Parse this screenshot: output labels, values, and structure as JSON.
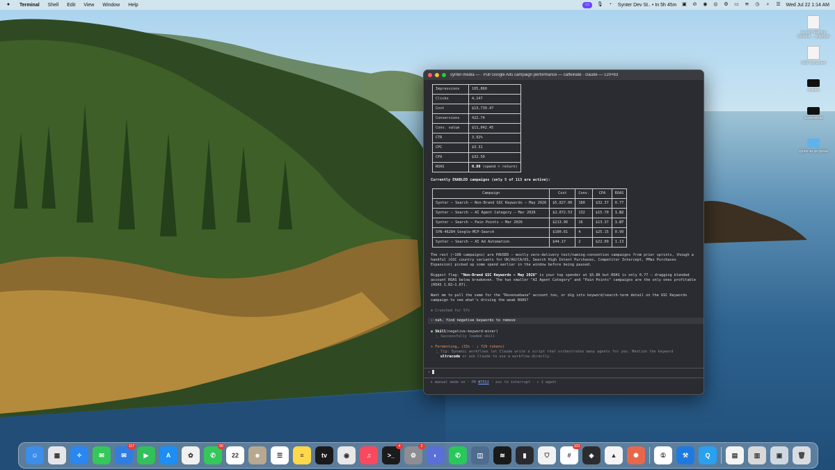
{
  "menubar": {
    "apple": "",
    "app_name": "Terminal",
    "menus": [
      "Shell",
      "Edit",
      "View",
      "Window",
      "Help"
    ],
    "status_item": "Synter Dev St.. • In 5h 45m",
    "datetime": "Wed Jul 22  1:14 AM"
  },
  "desktop_icons": [
    {
      "label": "Jackson Fashion Seminar ... script.pdf",
      "icon": "document-icon"
    },
    {
      "label": "WEF Document",
      "icon": "document-icon"
    },
    {
      "label": "Untitled",
      "icon": "display-icon"
    },
    {
      "label": "Screenshots",
      "icon": "printer-icon"
    },
    {
      "label": "synter-ex-proposal",
      "icon": "folder-icon"
    }
  ],
  "terminal": {
    "title": "synter-media — · Pull Google Ads campaign performance — caffeinate · claude — 120×63",
    "metrics": [
      {
        "label": "Impressions",
        "value": "105,860"
      },
      {
        "label": "Clicks",
        "value": "4,147"
      },
      {
        "label": "Cost",
        "value": "$13,739.47"
      },
      {
        "label": "Conversions",
        "value": "422.74"
      },
      {
        "label": "Conv. value",
        "value": "$11,042.45"
      },
      {
        "label": "CTR",
        "value": "3.92%"
      },
      {
        "label": "CPC",
        "value": "$3.31"
      },
      {
        "label": "CPA",
        "value": "$32.50"
      },
      {
        "label": "ROAS",
        "value": "0.80",
        "note": "(spend > return)"
      }
    ],
    "campaigns_heading": "Currently ENABLED campaigns (only 5 of 113 are active):",
    "campaign_headers": [
      "Campaign",
      "Cost",
      "Conv.",
      "CPA",
      "ROAS"
    ],
    "campaigns": [
      {
        "name": "Synter – Search – Non-Brand GSC Keywords – May 2026",
        "cost": "$5,827.06",
        "conv": "180",
        "cpa": "$32.37",
        "roas": "0.77"
      },
      {
        "name": "Synter – Search – AI Agent Category – Mar 2026",
        "cost": "$2,072.53",
        "conv": "132",
        "cpa": "$15.70",
        "roas": "1.82"
      },
      {
        "name": "Synter – Search – Pain Points – Mar 2026",
        "cost": "$213.96",
        "conv": "16",
        "cpa": "$13.37",
        "roas": "1.87"
      },
      {
        "name": "SYN-46284_Google-MCP-Search",
        "cost": "$100.61",
        "conv": "4",
        "cpa": "$25.15",
        "roas": "0.99"
      },
      {
        "name": "Synter – Search – AI Ad Automation",
        "cost": "$44.17",
        "conv": "2",
        "cpa": "$22.09",
        "roas": "1.13"
      }
    ],
    "para1": "The rest (~108 campaigns) are PAUSED — mostly zero-delivery test/naming-convention campaigns from prior sprints, though a handful (GSC country variants for UK/AU/CA/US, Search High Intent Purchases, Competitor Intercept, PMax Purchases Expansion) picked up some spend earlier in the window before being paused.",
    "para2_lead": "Biggest flag: ",
    "para2_bold": "\"Non-Brand GSC Keywords – May 2026\"",
    "para2_rest": " is your top spender at $5.8K but ROAS is only 0.77 — dragging blended account ROAS below breakeven. The two smaller \"AI Agent Category\" and \"Pain Points\" campaigns are the only ones profitable (ROAS 1.82–1.87).",
    "para3": "Want me to pull the same for the \"Revenuebase\" account too, or dig into keyword/search-term detail on the GSC Keywords campaign to see what's driving the weak ROAS?",
    "crunched": "✻ Crunched for 57s",
    "user_input": "› nah, find negative keywords to remove",
    "skill_name": "Skill",
    "skill_arg": "(negative-keyword-miner)",
    "skill_result": "⎿  Successfully loaded skill",
    "fermenting": "✶ Fermenting… (33s · ↓ 729 tokens)",
    "tip_text": "⎿  Tip: Dynamic workflows let Claude write a script that orchestrates many agents for you. Mention the keyword",
    "tip_keyword": "ultracode",
    "tip_text2": " or ask Claude to use a workflow directly.",
    "prompt_symbol": "›",
    "status_pre": "⏸ manual mode on · PR ",
    "status_pr": "#7553",
    "status_post": " · esc to interrupt · ✦ 1 agent"
  },
  "dock": {
    "apps": [
      {
        "name": "finder-icon",
        "color": "#3b8eea",
        "glyph": "☺",
        "badge": ""
      },
      {
        "name": "launchpad-icon",
        "color": "#e6e6ea",
        "glyph": "▦",
        "badge": ""
      },
      {
        "name": "safari-icon",
        "color": "#2a86f0",
        "glyph": "✧",
        "badge": ""
      },
      {
        "name": "messages-icon",
        "color": "#35c759",
        "glyph": "✉",
        "badge": ""
      },
      {
        "name": "mail-icon",
        "color": "#2f7de1",
        "glyph": "✉",
        "badge": "117"
      },
      {
        "name": "facetime-icon",
        "color": "#32c05a",
        "glyph": "▶",
        "badge": ""
      },
      {
        "name": "app-store-icon",
        "color": "#1c8ef5",
        "glyph": "A",
        "badge": ""
      },
      {
        "name": "photos-icon",
        "color": "#f0f0f0",
        "glyph": "✿",
        "badge": ""
      },
      {
        "name": "phone-icon",
        "color": "#34c759",
        "glyph": "✆",
        "badge": "60"
      },
      {
        "name": "calendar-icon",
        "color": "#ffffff",
        "glyph": "22",
        "badge": ""
      },
      {
        "name": "contacts-icon",
        "color": "#b9a890",
        "glyph": "☻",
        "badge": ""
      },
      {
        "name": "reminders-icon",
        "color": "#ffffff",
        "glyph": "☰",
        "badge": ""
      },
      {
        "name": "notes-icon",
        "color": "#ffd84a",
        "glyph": "≡",
        "badge": ""
      },
      {
        "name": "apple-tv-icon",
        "color": "#1a1a1a",
        "glyph": "tv",
        "badge": ""
      },
      {
        "name": "chrome-icon",
        "color": "#e8e8e8",
        "glyph": "◉",
        "badge": ""
      },
      {
        "name": "music-icon",
        "color": "#f9495f",
        "glyph": "♫",
        "badge": ""
      },
      {
        "name": "terminal-icon",
        "color": "#1b1b1b",
        "glyph": ">_",
        "badge": "4"
      },
      {
        "name": "system-settings-icon",
        "color": "#8d8d93",
        "glyph": "⚙",
        "badge": "2"
      },
      {
        "name": "arc-browser-icon",
        "color": "#5a6fd8",
        "glyph": "◐",
        "badge": ""
      },
      {
        "name": "whatsapp-icon",
        "color": "#29c85b",
        "glyph": "✆",
        "badge": ""
      },
      {
        "name": "database-icon",
        "color": "#4d6c8e",
        "glyph": "◫",
        "badge": ""
      },
      {
        "name": "spotify-icon",
        "color": "#1a1a1a",
        "glyph": "≋",
        "badge": ""
      },
      {
        "name": "audio-meter-icon",
        "color": "#2a2a30",
        "glyph": "▮",
        "badge": ""
      },
      {
        "name": "shield-icon",
        "color": "#f2f2f2",
        "glyph": "⛉",
        "badge": ""
      },
      {
        "name": "slack-icon",
        "color": "#ffffff",
        "glyph": "#",
        "badge": "103"
      },
      {
        "name": "layers-icon",
        "color": "#2c2c2e",
        "glyph": "◈",
        "badge": ""
      },
      {
        "name": "google-ads-icon",
        "color": "#f4f4f4",
        "glyph": "▲",
        "badge": ""
      },
      {
        "name": "claude-icon",
        "color": "#e8674a",
        "glyph": "✺",
        "badge": ""
      },
      {
        "name": "1password-icon",
        "color": "#ffffff",
        "glyph": "①",
        "badge": ""
      },
      {
        "name": "xcode-icon",
        "color": "#1f7ae0",
        "glyph": "⚒",
        "badge": ""
      },
      {
        "name": "quicklook-icon",
        "color": "#2aa0f0",
        "glyph": "Q",
        "badge": ""
      },
      {
        "name": "document-icon",
        "color": "#f4f4f4",
        "glyph": "▤",
        "badge": ""
      },
      {
        "name": "stack-icon",
        "color": "#d8d8d8",
        "glyph": "▥",
        "badge": ""
      },
      {
        "name": "preview-icon",
        "color": "#cfd8e0",
        "glyph": "▣",
        "badge": ""
      },
      {
        "name": "trash-icon",
        "color": "#d9dde2",
        "glyph": "🗑",
        "badge": ""
      }
    ]
  }
}
